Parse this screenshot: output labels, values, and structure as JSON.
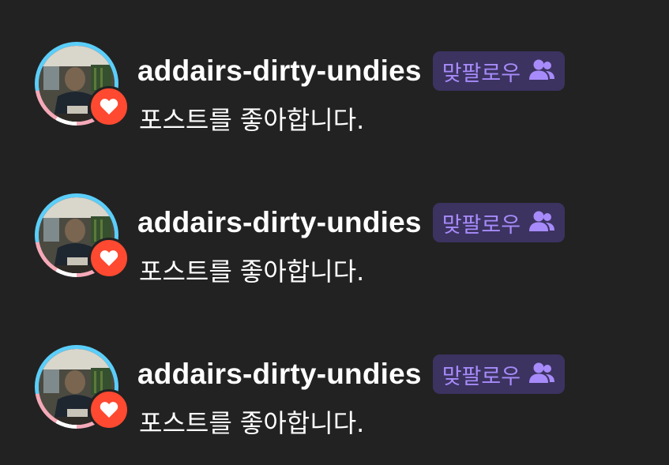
{
  "accent": {
    "heart_badge": "#ff4930",
    "mutual_badge_bg": "#3c3361",
    "mutual_badge_fg": "#a78bfa",
    "avatar_ring": [
      "#5bcefa",
      "#f5a9b8",
      "#ffffff"
    ]
  },
  "notifications": [
    {
      "username": "addairs-dirty-undies",
      "badge_label": "맞팔로우",
      "badge_icon": "people-icon",
      "status_icon": "heart-icon",
      "message": "포스트를 좋아합니다."
    },
    {
      "username": "addairs-dirty-undies",
      "badge_label": "맞팔로우",
      "badge_icon": "people-icon",
      "status_icon": "heart-icon",
      "message": "포스트를 좋아합니다."
    },
    {
      "username": "addairs-dirty-undies",
      "badge_label": "맞팔로우",
      "badge_icon": "people-icon",
      "status_icon": "heart-icon",
      "message": "포스트를 좋아합니다."
    }
  ]
}
